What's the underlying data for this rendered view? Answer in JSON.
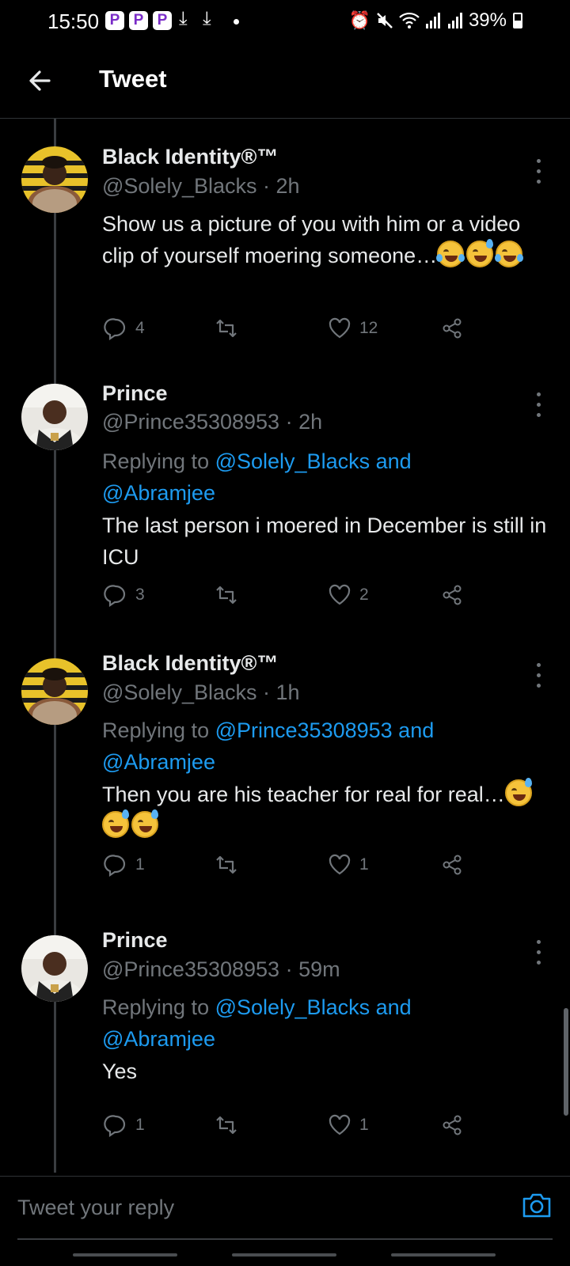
{
  "status_bar": {
    "time": "15:50",
    "app_badge": "P",
    "battery": "39%"
  },
  "header": {
    "title": "Tweet"
  },
  "tweets": [
    {
      "name": "Black Identity®™",
      "handle_time": "@Solely_Blacks · 2h",
      "replying_prefix": "",
      "replying_to": "",
      "and_word": "",
      "second_mention": "",
      "body": "Show us a picture of you with him or a video clip of yourself moering someone…",
      "emojis": [
        "face-with-tears-of-joy",
        "grinning-sweat",
        "face-with-tears-of-joy"
      ],
      "replies": "4",
      "retweets": "",
      "likes": "12"
    },
    {
      "name": "Prince",
      "handle_time": "@Prince35308953 · 2h",
      "replying_prefix": "Replying to ",
      "replying_to": "@Solely_Blacks",
      "and_word": " and",
      "second_mention": "@Abramjee",
      "body": "The last person i moered in December is still in ICU",
      "emojis": [],
      "replies": "3",
      "retweets": "",
      "likes": "2"
    },
    {
      "name": "Black Identity®™",
      "handle_time": "@Solely_Blacks · 1h",
      "replying_prefix": "Replying to ",
      "replying_to": "@Prince35308953",
      "and_word": " and",
      "second_mention": "@Abramjee",
      "body": "Then you are his teacher for real for real…",
      "emojis": [
        "grinning-sweat",
        "grinning-sweat",
        "grinning-sweat"
      ],
      "replies": "1",
      "retweets": "",
      "likes": "1"
    },
    {
      "name": "Prince",
      "handle_time": "@Prince35308953 · 59m",
      "replying_prefix": "Replying to ",
      "replying_to": "@Solely_Blacks",
      "and_word": " and",
      "second_mention": "@Abramjee",
      "body": "Yes",
      "emojis": [],
      "replies": "1",
      "retweets": "",
      "likes": "1"
    }
  ],
  "reply_bar": {
    "placeholder": "Tweet your reply"
  },
  "colors": {
    "background": "#000000",
    "link": "#1d9bf0",
    "muted": "#71767b",
    "text": "#e7e9ea"
  },
  "icons": {
    "back": "arrow-left-icon",
    "more": "more-vertical-icon",
    "reply": "reply-bubble-icon",
    "retweet": "retweet-icon",
    "like": "heart-icon",
    "share": "share-icon",
    "camera": "camera-icon"
  }
}
